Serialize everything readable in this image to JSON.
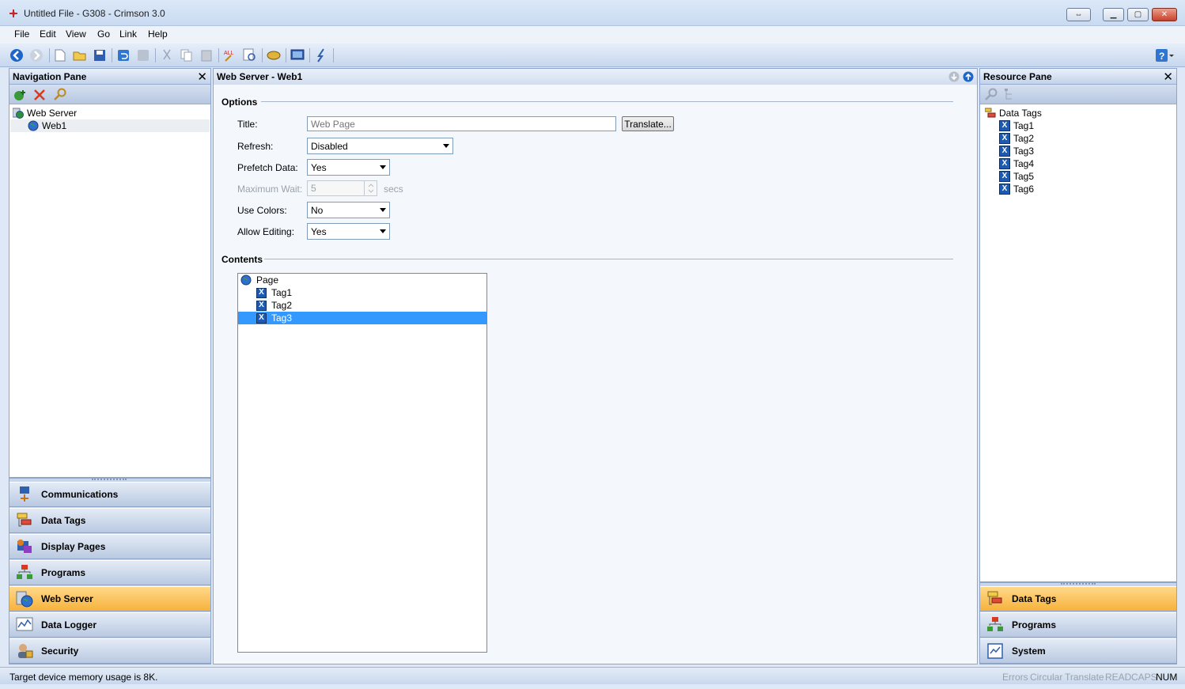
{
  "window": {
    "title": "Untitled File - G308 - Crimson 3.0"
  },
  "menu": [
    "File",
    "Edit",
    "View",
    "Go",
    "Link",
    "Help"
  ],
  "navigation_pane": {
    "title": "Navigation Pane",
    "tree": [
      {
        "label": "Web Server"
      },
      {
        "label": "Web1"
      }
    ],
    "categories": [
      {
        "label": "Communications",
        "icon": "communications-icon"
      },
      {
        "label": "Data Tags",
        "icon": "data-tags-icon"
      },
      {
        "label": "Display Pages",
        "icon": "display-pages-icon"
      },
      {
        "label": "Programs",
        "icon": "programs-icon"
      },
      {
        "label": "Web Server",
        "icon": "web-server-icon",
        "active": true
      },
      {
        "label": "Data Logger",
        "icon": "data-logger-icon"
      },
      {
        "label": "Security",
        "icon": "security-icon"
      }
    ]
  },
  "editor": {
    "title": "Web Server - Web1",
    "options_label": "Options",
    "fields": {
      "title_label": "Title:",
      "title_placeholder": "Web Page",
      "translate_button": "Translate...",
      "refresh_label": "Refresh:",
      "refresh_value": "Disabled",
      "prefetch_label": "Prefetch Data:",
      "prefetch_value": "Yes",
      "max_wait_label": "Maximum Wait:",
      "max_wait_value": "5",
      "max_wait_unit": "secs",
      "use_colors_label": "Use Colors:",
      "use_colors_value": "No",
      "allow_editing_label": "Allow Editing:",
      "allow_editing_value": "Yes"
    },
    "contents_label": "Contents",
    "contents": [
      {
        "label": "Page"
      },
      {
        "label": "Tag1"
      },
      {
        "label": "Tag2"
      },
      {
        "label": "Tag3"
      }
    ]
  },
  "resource_pane": {
    "title": "Resource Pane",
    "tree_root": "Data Tags",
    "tags": [
      "Tag1",
      "Tag2",
      "Tag3",
      "Tag4",
      "Tag5",
      "Tag6"
    ],
    "categories": [
      {
        "label": "Data Tags",
        "active": true
      },
      {
        "label": "Programs"
      },
      {
        "label": "System"
      }
    ]
  },
  "status": {
    "message": "Target device memory usage is 8K.",
    "indicators": [
      {
        "label": "Errors",
        "on": false
      },
      {
        "label": "Circular",
        "on": false
      },
      {
        "label": "Translate",
        "on": false
      },
      {
        "label": "READ",
        "on": false
      },
      {
        "label": "CAPS",
        "on": false
      },
      {
        "label": "NUM",
        "on": true
      }
    ]
  },
  "colors": {
    "accent_active": "#f7b23c",
    "selection": "#3399ff",
    "pane_border": "#8da5c9"
  }
}
